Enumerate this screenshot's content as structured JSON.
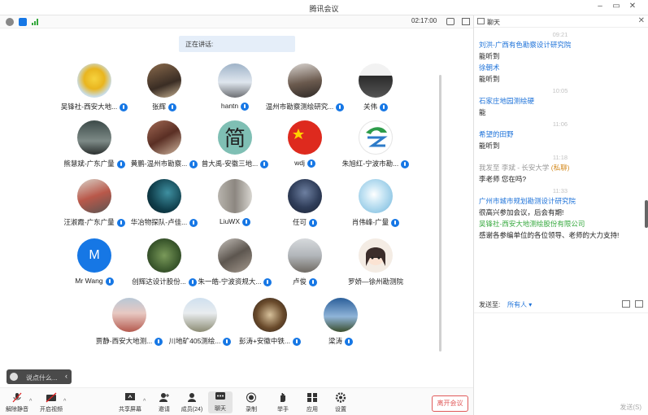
{
  "window": {
    "title": "腾讯会议"
  },
  "meeting": {
    "timer": "02:17:00",
    "speaking_label": "正在讲话:"
  },
  "participants": [
    {
      "name": "吴锋社-西安大地..."
    },
    {
      "name": "张辉"
    },
    {
      "name": "hantn"
    },
    {
      "name": "温州市勘察测绘研究..."
    },
    {
      "name": "关伟"
    },
    {
      "name": "熊慧斌-广东广量"
    },
    {
      "name": "黄鹏-温州市勘察..."
    },
    {
      "name": "曾大禹-安徽三地..."
    },
    {
      "name": "wdj"
    },
    {
      "name": "朱旭红-宁波市勘..."
    },
    {
      "name": "汪淑霞-广东广量"
    },
    {
      "name": "华冶物探队-卢佳..."
    },
    {
      "name": "LiuWX"
    },
    {
      "name": "任可"
    },
    {
      "name": "肖伟峰-广量"
    },
    {
      "name": "Mr Wang",
      "initial": "M"
    },
    {
      "name": "创辉达设计股份..."
    },
    {
      "name": "朱一皓-宁波资规大..."
    },
    {
      "name": "卢俊"
    },
    {
      "name": "罗娇—徐州勘测院"
    },
    {
      "name": "贾静-西安大地测..."
    },
    {
      "name": "川地矿405测绘..."
    },
    {
      "name": "彭涛+安徽中铁..."
    },
    {
      "name": "梁涛"
    }
  ],
  "chat_input": {
    "placeholder": "说点什么..."
  },
  "toolbar": {
    "mute": "解除静音",
    "video": "开启视频",
    "share": "共享屏幕",
    "invite": "邀请",
    "members": "成员(24)",
    "chat": "聊天",
    "record": "录制",
    "raise_hand": "举手",
    "apps": "应用",
    "settings": "设置",
    "leave": "离开会议"
  },
  "chat_panel": {
    "title": "聊天",
    "send_to_label": "发送至:",
    "send_to_value": "所有人",
    "send_button": "发送(S)",
    "messages": [
      {
        "time": "09:21",
        "sender": "刘洪-广西有色勘察设计研究院",
        "text": "能听到"
      },
      {
        "sender": "徐朝术",
        "text": "能听到"
      },
      {
        "time": "10:05",
        "sender": "石家庄地园测绘硬",
        "text": "能"
      },
      {
        "time": "11:06",
        "sender": "希望的田野",
        "text": "能听到"
      },
      {
        "time": "11:18",
        "sender_prefix": "我发至 李斌 - 长安大学",
        "sender_tag": "(私聊)",
        "text": "李老师 您在吗?"
      },
      {
        "time": "11:33",
        "sender": "广州市城市规划勘测设计研究院",
        "text": "很高兴参加会议，后会有期!"
      },
      {
        "sender": "吴锋社-西安大地测绘股份有限公司",
        "text": "感谢各参编单位的各位领导、老师的大力支持!"
      }
    ]
  }
}
